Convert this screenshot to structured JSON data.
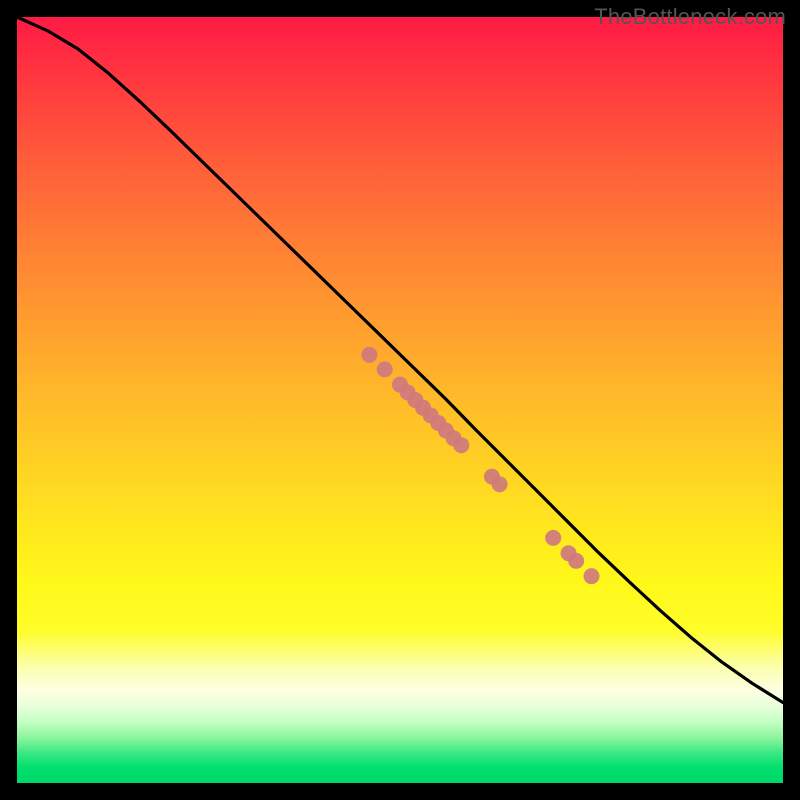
{
  "watermark": "TheBottleneck.com",
  "chart_data": {
    "type": "line",
    "title": "",
    "xlabel": "",
    "ylabel": "",
    "xlim": [
      0,
      100
    ],
    "ylim": [
      0,
      100
    ],
    "curve": {
      "name": "curve",
      "x": [
        0,
        4,
        8,
        12,
        16,
        20,
        24,
        28,
        32,
        36,
        40,
        44,
        48,
        52,
        56,
        60,
        64,
        68,
        72,
        76,
        80,
        84,
        88,
        92,
        96,
        100
      ],
      "y": [
        100,
        98.2,
        95.8,
        92.6,
        89.0,
        85.2,
        81.3,
        77.4,
        73.5,
        69.6,
        65.7,
        61.8,
        57.9,
        54.0,
        50.1,
        46.0,
        42.0,
        38.0,
        34.0,
        30.0,
        26.2,
        22.5,
        19.0,
        15.8,
        13.0,
        10.5
      ]
    },
    "markers": {
      "name": "points",
      "x": [
        46,
        48,
        50,
        51,
        52,
        53,
        54,
        55,
        56,
        57,
        58,
        62,
        63,
        70,
        72,
        73,
        75
      ],
      "y": [
        55.9,
        54.0,
        52.0,
        51.0,
        50.0,
        49.0,
        48.0,
        47.0,
        46.0,
        45.0,
        44.1,
        40.0,
        39.0,
        32.0,
        30.0,
        29.0,
        27.0
      ]
    },
    "marker_color": "#cf7a7d",
    "marker_radius_px": 8
  }
}
